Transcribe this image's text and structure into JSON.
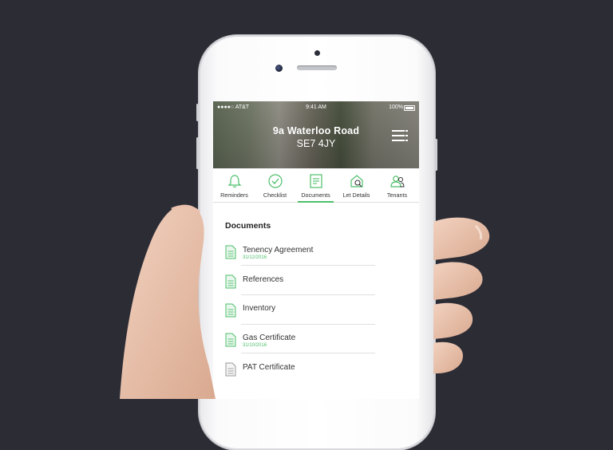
{
  "status_bar": {
    "carrier": "●●●●○ AT&T",
    "time": "9:41 AM",
    "battery": "100%"
  },
  "property": {
    "line1": "9a Waterloo Road",
    "line2": "SE7 4JY"
  },
  "tabs": [
    {
      "label": "Reminders",
      "icon": "bell-icon"
    },
    {
      "label": "Checklist",
      "icon": "check-circle-icon"
    },
    {
      "label": "Documents",
      "icon": "document-list-icon",
      "active": true
    },
    {
      "label": "Let Details",
      "icon": "house-search-icon"
    },
    {
      "label": "Tenants",
      "icon": "people-icon"
    }
  ],
  "documents": {
    "title": "Documents",
    "items": [
      {
        "name": "Tenency Agreement",
        "date": "31/12/2016"
      },
      {
        "name": "References",
        "date": ""
      },
      {
        "name": "Inventory",
        "date": ""
      },
      {
        "name": "Gas Certificate",
        "date": "31/10/2016"
      },
      {
        "name": "PAT Certificate",
        "date": ""
      }
    ]
  },
  "colors": {
    "background": "#2c2c35",
    "accent": "#4cbf6a"
  }
}
